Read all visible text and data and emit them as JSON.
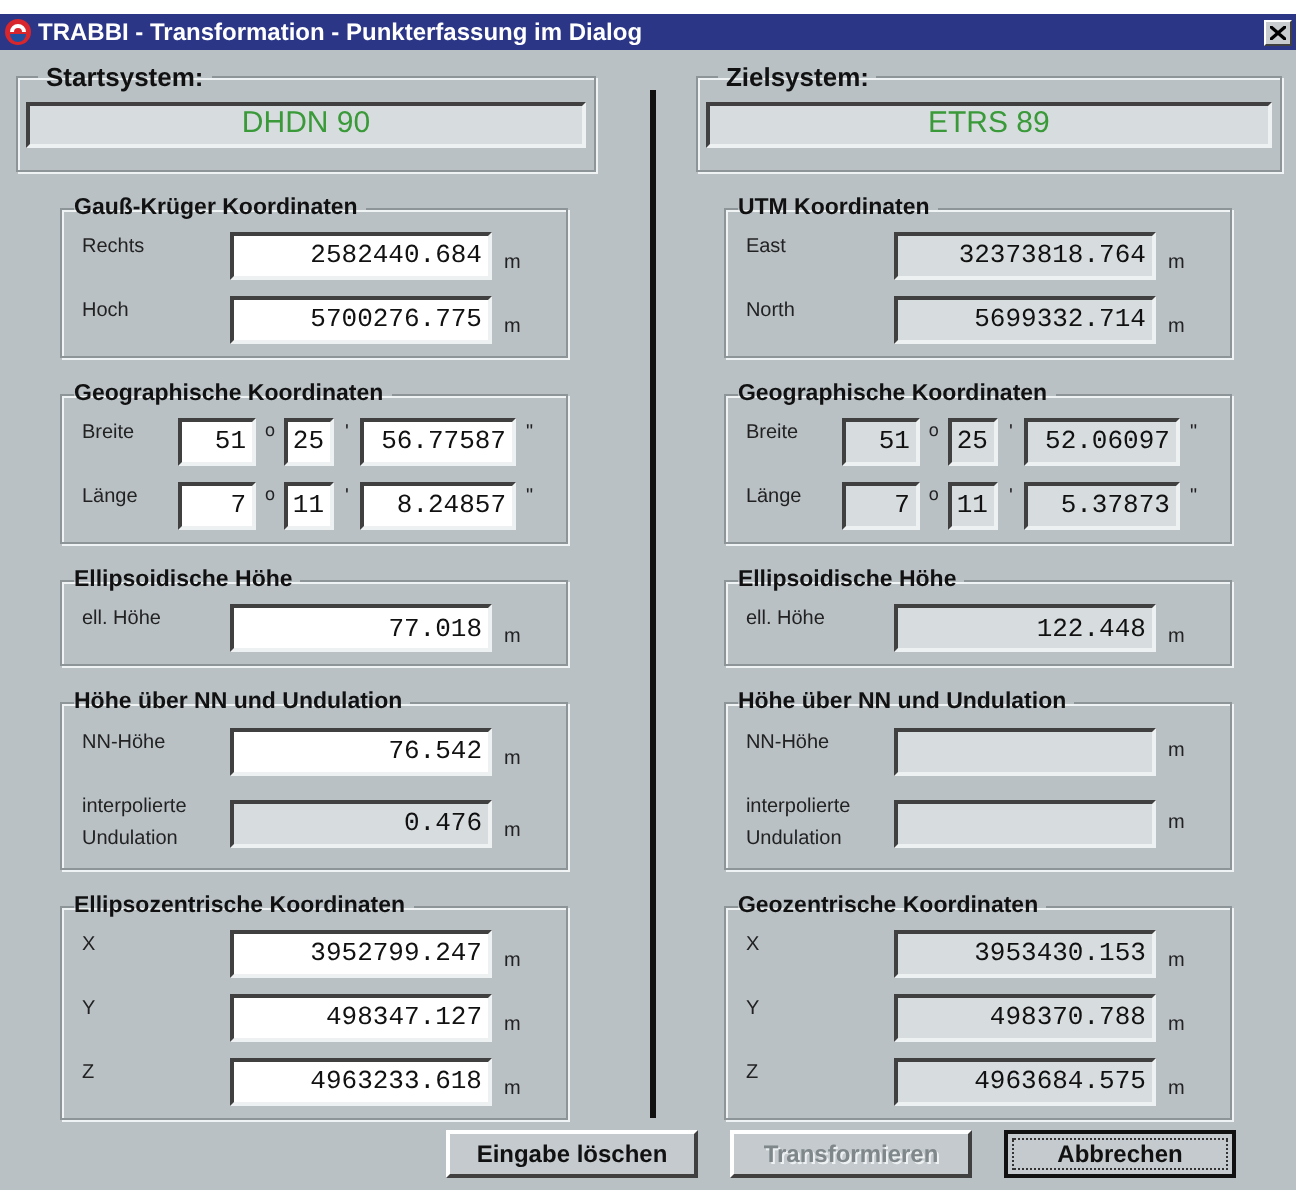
{
  "window": {
    "title": "TRABBI - Transformation - Punkterfassung im Dialog"
  },
  "columns": [
    {
      "system_label": "Startsystem:",
      "system_name": "DHDN 90",
      "groups": [
        {
          "title": "Gauß-Krüger Koordinaten",
          "rows": [
            {
              "kind": "value",
              "label": "Rechts",
              "editable": true,
              "value": "2582440.684",
              "unit": "m"
            },
            {
              "kind": "value",
              "label": "Hoch",
              "editable": true,
              "value": "5700276.775",
              "unit": "m"
            }
          ]
        },
        {
          "title": "Geographische Koordinaten",
          "rows": [
            {
              "kind": "dms",
              "label": "Breite",
              "editable": true,
              "degrees": "51",
              "deg_sign": "o",
              "minutes": "25",
              "min_sign": "'",
              "seconds": "56.77587",
              "sec_sign": "\""
            },
            {
              "kind": "dms",
              "label": "Länge",
              "editable": true,
              "degrees": "7",
              "deg_sign": "o",
              "minutes": "11",
              "min_sign": "'",
              "seconds": "8.24857",
              "sec_sign": "\""
            }
          ]
        },
        {
          "title": "Ellipsoidische Höhe",
          "rows": [
            {
              "kind": "value",
              "label": "ell. Höhe",
              "editable": true,
              "value": "77.018",
              "unit": "m"
            }
          ]
        },
        {
          "title": "Höhe über NN und Undulation",
          "rows": [
            {
              "kind": "value",
              "label": "NN-Höhe",
              "editable": true,
              "value": "76.542",
              "unit": "m"
            },
            {
              "kind": "value",
              "label": "interpolierte Undulation",
              "editable": false,
              "value": "0.476",
              "unit": "m"
            }
          ]
        },
        {
          "title": "Ellipsozentrische Koordinaten",
          "rows": [
            {
              "kind": "value",
              "label": "X",
              "editable": true,
              "value": "3952799.247",
              "unit": "m"
            },
            {
              "kind": "value",
              "label": "Y",
              "editable": true,
              "value": "498347.127",
              "unit": "m"
            },
            {
              "kind": "value",
              "label": "Z",
              "editable": true,
              "value": "4963233.618",
              "unit": "m"
            }
          ]
        }
      ]
    },
    {
      "system_label": "Zielsystem:",
      "system_name": "ETRS 89",
      "groups": [
        {
          "title": "UTM Koordinaten",
          "rows": [
            {
              "kind": "value",
              "label": "East",
              "editable": false,
              "value": "32373818.764",
              "unit": "m"
            },
            {
              "kind": "value",
              "label": "North",
              "editable": false,
              "value": "5699332.714",
              "unit": "m"
            }
          ]
        },
        {
          "title": "Geographische Koordinaten",
          "rows": [
            {
              "kind": "dms",
              "label": "Breite",
              "editable": false,
              "degrees": "51",
              "deg_sign": "o",
              "minutes": "25",
              "min_sign": "'",
              "seconds": "52.06097",
              "sec_sign": "\""
            },
            {
              "kind": "dms",
              "label": "Länge",
              "editable": false,
              "degrees": "7",
              "deg_sign": "o",
              "minutes": "11",
              "min_sign": "'",
              "seconds": "5.37873",
              "sec_sign": "\""
            }
          ]
        },
        {
          "title": "Ellipsoidische Höhe",
          "rows": [
            {
              "kind": "value",
              "label": "ell. Höhe",
              "editable": false,
              "value": "122.448",
              "unit": "m"
            }
          ]
        },
        {
          "title": "Höhe über NN und Undulation",
          "rows": [
            {
              "kind": "value",
              "label": "NN-Höhe",
              "editable": false,
              "unit": "m"
            },
            {
              "kind": "value",
              "label": "interpolierte Undulation",
              "editable": false,
              "unit": "m"
            }
          ]
        },
        {
          "title": "Geozentrische Koordinaten",
          "rows": [
            {
              "kind": "value",
              "label": "X",
              "editable": false,
              "value": "3953430.153",
              "unit": "m"
            },
            {
              "kind": "value",
              "label": "Y",
              "editable": false,
              "value": "498370.788",
              "unit": "m"
            },
            {
              "kind": "value",
              "label": "Z",
              "editable": false,
              "value": "4963684.575",
              "unit": "m"
            }
          ]
        }
      ]
    }
  ],
  "buttons": [
    {
      "label": "Eingabe löschen",
      "disabled": false,
      "focused": false
    },
    {
      "label": "Transformieren",
      "disabled": true,
      "focused": false
    },
    {
      "label": "Abbrechen",
      "disabled": false,
      "focused": true
    }
  ]
}
